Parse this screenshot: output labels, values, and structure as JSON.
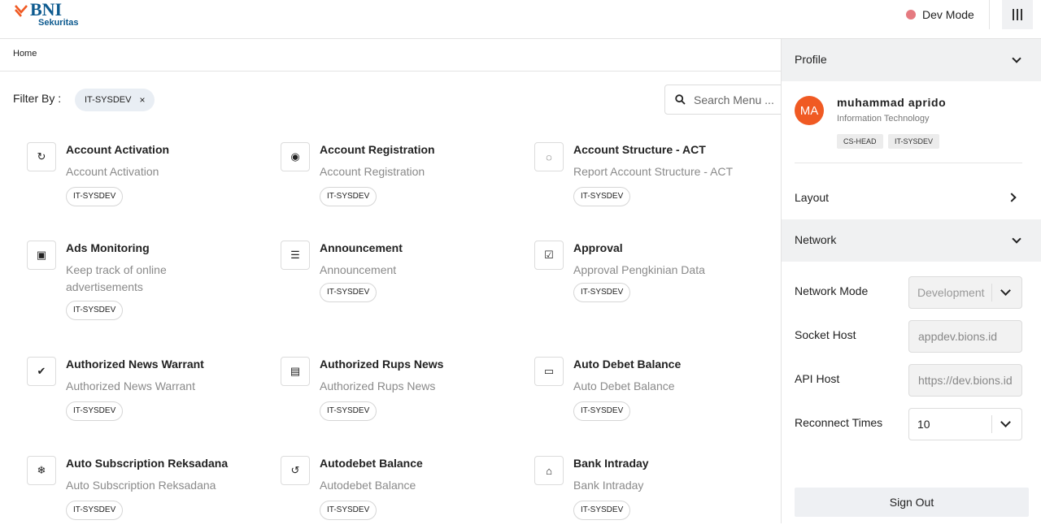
{
  "header": {
    "logo_text": "BNI",
    "logo_subtext": "Sekuritas",
    "dev_mode_label": "Dev Mode",
    "menu_icon": "columns-menu-icon"
  },
  "breadcrumb": {
    "home": "Home"
  },
  "filter": {
    "label": "Filter By :",
    "chip": "IT-SYSDEV",
    "chip_close": "×"
  },
  "search": {
    "placeholder": "Search Menu ..."
  },
  "menu_cards": [
    {
      "title": "Account Activation",
      "desc": "Account Activation",
      "tag": "IT-SYSDEV",
      "icon": "rotate-3d-icon"
    },
    {
      "title": "Account Registration",
      "desc": "Account Registration",
      "tag": "IT-SYSDEV",
      "icon": "user-circle-icon"
    },
    {
      "title": "Account Structure - ACT",
      "desc": "Report Account Structure - ACT",
      "tag": "IT-SYSDEV",
      "icon": "circle-notch-icon"
    },
    {
      "title": "Ads Monitoring",
      "desc": "Keep track of online advertisements",
      "tag": "IT-SYSDEV",
      "icon": "id-card-icon"
    },
    {
      "title": "Announcement",
      "desc": "Announcement",
      "tag": "IT-SYSDEV",
      "icon": "newspaper-icon"
    },
    {
      "title": "Approval",
      "desc": "Approval Pengkinian Data",
      "tag": "IT-SYSDEV",
      "icon": "checkbox-icon"
    },
    {
      "title": "Authorized News Warrant",
      "desc": "Authorized News Warrant",
      "tag": "IT-SYSDEV",
      "icon": "badge-check-icon"
    },
    {
      "title": "Authorized Rups News",
      "desc": "Authorized Rups News",
      "tag": "IT-SYSDEV",
      "icon": "box-open-icon"
    },
    {
      "title": "Auto Debet Balance",
      "desc": "Auto Debet Balance",
      "tag": "IT-SYSDEV",
      "icon": "monitor-icon"
    },
    {
      "title": "Auto Subscription Reksadana",
      "desc": "Auto Subscription Reksadana",
      "tag": "IT-SYSDEV",
      "icon": "snowflake-icon"
    },
    {
      "title": "Autodebet Balance",
      "desc": "Autodebet Balance",
      "tag": "IT-SYSDEV",
      "icon": "refresh-icon"
    },
    {
      "title": "Bank Intraday",
      "desc": "Bank Intraday",
      "tag": "IT-SYSDEV",
      "icon": "bank-icon"
    }
  ],
  "panel": {
    "profile_label": "Profile",
    "avatar_initials": "MA",
    "user_name": "muhammad aprido",
    "user_dept": "Information Technology",
    "user_tags": [
      "CS-HEAD",
      "IT-SYSDEV"
    ],
    "layout_label": "Layout",
    "network_label": "Network",
    "fields": {
      "network_mode_label": "Network Mode",
      "network_mode_value": "Development",
      "socket_host_label": "Socket Host",
      "socket_host_value": "appdev.bions.id",
      "api_host_label": "API Host",
      "api_host_value": "https://dev.bions.id",
      "reconnect_label": "Reconnect Times",
      "reconnect_value": "10"
    },
    "sign_out": "Sign Out"
  },
  "colors": {
    "brand_blue": "#0d5a8f",
    "brand_orange": "#f05a23",
    "dev_dot": "#e57a80"
  }
}
